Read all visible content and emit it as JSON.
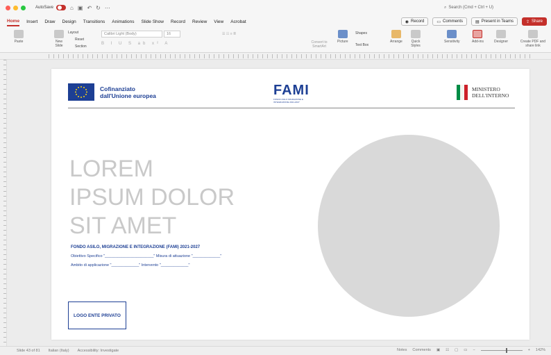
{
  "titlebar": {
    "autosave_label": "AutoSave",
    "search_placeholder": "Search (Cmd + Ctrl + U)"
  },
  "tabs": [
    "Home",
    "Insert",
    "Draw",
    "Design",
    "Transitions",
    "Animations",
    "Slide Show",
    "Record",
    "Review",
    "View",
    "Acrobat"
  ],
  "tabs_right": {
    "record": "Record",
    "comments": "Comments",
    "present": "Present in Teams",
    "share": "Share"
  },
  "ribbon": {
    "paste": "Paste",
    "new_slide": "New Slide",
    "layout": "Layout",
    "reset": "Reset",
    "section": "Section",
    "font_name": "Calibri Light (Body)",
    "font_size": "16",
    "convert": "Convert to SmartArt",
    "picture": "Picture",
    "shapes": "Shapes",
    "text_box": "Text Box",
    "arrange": "Arrange",
    "quick_styles": "Quick Styles",
    "sensitivity": "Sensitivity",
    "addins": "Add-ins",
    "designer": "Designer",
    "create_pdf": "Create PDF and share link"
  },
  "slide": {
    "eu_line1": "Cofinanziato",
    "eu_line2": "dall'Unione europea",
    "fami_logo": "FAMI",
    "fami_sub": "FONDO ASILO MIGRAZIONE E INTEGRAZIONE 2021-2027",
    "ministero_line1": "MINISTERO",
    "ministero_line2": "DELL'INTERNO",
    "headline_line1": "LOREM",
    "headline_line2": "IPSUM DOLOR",
    "headline_line3": "SIT AMET",
    "fondo_title": "FONDO ASILO, MIGRAZIONE E INTEGRAZIONE (FAMI) 2021-2027",
    "field_row1": "Obiettivo Specifico \"_______________________\"  Misura di attuazione \"_____________\"",
    "field_row2": "Ambito di applicazione \"_____________\" Intervento \"_____________\"",
    "logo_box": "LOGO ENTE PRIVATO"
  },
  "statusbar": {
    "slide_info": "Slide 43 of 81",
    "language": "Italian (Italy)",
    "accessibility": "Accessibility: Investigate",
    "notes": "Notes",
    "comments": "Comments",
    "zoom": "142%"
  },
  "colors": {
    "accent": "#c4302b",
    "eu_blue": "#1d3f94",
    "headline_grey": "#c9c9c9",
    "placeholder_circle": "#d9d9d9"
  }
}
